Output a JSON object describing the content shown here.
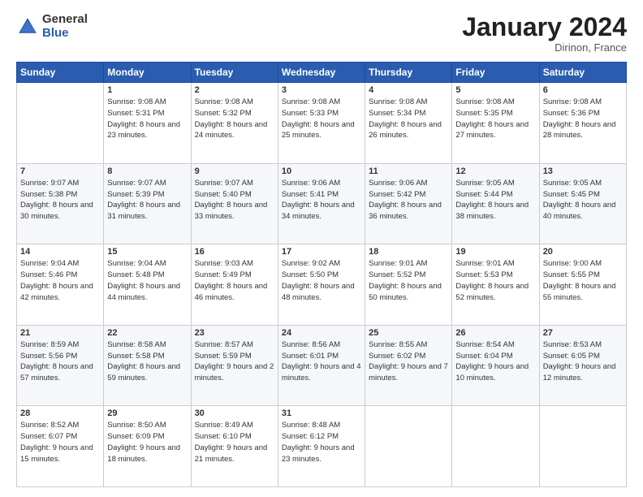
{
  "logo": {
    "general": "General",
    "blue": "Blue"
  },
  "header": {
    "month": "January 2024",
    "location": "Dirinon, France"
  },
  "weekdays": [
    "Sunday",
    "Monday",
    "Tuesday",
    "Wednesday",
    "Thursday",
    "Friday",
    "Saturday"
  ],
  "weeks": [
    [
      {
        "day": "",
        "sunrise": "",
        "sunset": "",
        "daylight": ""
      },
      {
        "day": "1",
        "sunrise": "9:08 AM",
        "sunset": "5:31 PM",
        "daylight": "8 hours and 23 minutes."
      },
      {
        "day": "2",
        "sunrise": "9:08 AM",
        "sunset": "5:32 PM",
        "daylight": "8 hours and 24 minutes."
      },
      {
        "day": "3",
        "sunrise": "9:08 AM",
        "sunset": "5:33 PM",
        "daylight": "8 hours and 25 minutes."
      },
      {
        "day": "4",
        "sunrise": "9:08 AM",
        "sunset": "5:34 PM",
        "daylight": "8 hours and 26 minutes."
      },
      {
        "day": "5",
        "sunrise": "9:08 AM",
        "sunset": "5:35 PM",
        "daylight": "8 hours and 27 minutes."
      },
      {
        "day": "6",
        "sunrise": "9:08 AM",
        "sunset": "5:36 PM",
        "daylight": "8 hours and 28 minutes."
      }
    ],
    [
      {
        "day": "7",
        "sunrise": "9:07 AM",
        "sunset": "5:38 PM",
        "daylight": "8 hours and 30 minutes."
      },
      {
        "day": "8",
        "sunrise": "9:07 AM",
        "sunset": "5:39 PM",
        "daylight": "8 hours and 31 minutes."
      },
      {
        "day": "9",
        "sunrise": "9:07 AM",
        "sunset": "5:40 PM",
        "daylight": "8 hours and 33 minutes."
      },
      {
        "day": "10",
        "sunrise": "9:06 AM",
        "sunset": "5:41 PM",
        "daylight": "8 hours and 34 minutes."
      },
      {
        "day": "11",
        "sunrise": "9:06 AM",
        "sunset": "5:42 PM",
        "daylight": "8 hours and 36 minutes."
      },
      {
        "day": "12",
        "sunrise": "9:05 AM",
        "sunset": "5:44 PM",
        "daylight": "8 hours and 38 minutes."
      },
      {
        "day": "13",
        "sunrise": "9:05 AM",
        "sunset": "5:45 PM",
        "daylight": "8 hours and 40 minutes."
      }
    ],
    [
      {
        "day": "14",
        "sunrise": "9:04 AM",
        "sunset": "5:46 PM",
        "daylight": "8 hours and 42 minutes."
      },
      {
        "day": "15",
        "sunrise": "9:04 AM",
        "sunset": "5:48 PM",
        "daylight": "8 hours and 44 minutes."
      },
      {
        "day": "16",
        "sunrise": "9:03 AM",
        "sunset": "5:49 PM",
        "daylight": "8 hours and 46 minutes."
      },
      {
        "day": "17",
        "sunrise": "9:02 AM",
        "sunset": "5:50 PM",
        "daylight": "8 hours and 48 minutes."
      },
      {
        "day": "18",
        "sunrise": "9:01 AM",
        "sunset": "5:52 PM",
        "daylight": "8 hours and 50 minutes."
      },
      {
        "day": "19",
        "sunrise": "9:01 AM",
        "sunset": "5:53 PM",
        "daylight": "8 hours and 52 minutes."
      },
      {
        "day": "20",
        "sunrise": "9:00 AM",
        "sunset": "5:55 PM",
        "daylight": "8 hours and 55 minutes."
      }
    ],
    [
      {
        "day": "21",
        "sunrise": "8:59 AM",
        "sunset": "5:56 PM",
        "daylight": "8 hours and 57 minutes."
      },
      {
        "day": "22",
        "sunrise": "8:58 AM",
        "sunset": "5:58 PM",
        "daylight": "8 hours and 59 minutes."
      },
      {
        "day": "23",
        "sunrise": "8:57 AM",
        "sunset": "5:59 PM",
        "daylight": "9 hours and 2 minutes."
      },
      {
        "day": "24",
        "sunrise": "8:56 AM",
        "sunset": "6:01 PM",
        "daylight": "9 hours and 4 minutes."
      },
      {
        "day": "25",
        "sunrise": "8:55 AM",
        "sunset": "6:02 PM",
        "daylight": "9 hours and 7 minutes."
      },
      {
        "day": "26",
        "sunrise": "8:54 AM",
        "sunset": "6:04 PM",
        "daylight": "9 hours and 10 minutes."
      },
      {
        "day": "27",
        "sunrise": "8:53 AM",
        "sunset": "6:05 PM",
        "daylight": "9 hours and 12 minutes."
      }
    ],
    [
      {
        "day": "28",
        "sunrise": "8:52 AM",
        "sunset": "6:07 PM",
        "daylight": "9 hours and 15 minutes."
      },
      {
        "day": "29",
        "sunrise": "8:50 AM",
        "sunset": "6:09 PM",
        "daylight": "9 hours and 18 minutes."
      },
      {
        "day": "30",
        "sunrise": "8:49 AM",
        "sunset": "6:10 PM",
        "daylight": "9 hours and 21 minutes."
      },
      {
        "day": "31",
        "sunrise": "8:48 AM",
        "sunset": "6:12 PM",
        "daylight": "9 hours and 23 minutes."
      },
      {
        "day": "",
        "sunrise": "",
        "sunset": "",
        "daylight": ""
      },
      {
        "day": "",
        "sunrise": "",
        "sunset": "",
        "daylight": ""
      },
      {
        "day": "",
        "sunrise": "",
        "sunset": "",
        "daylight": ""
      }
    ]
  ]
}
